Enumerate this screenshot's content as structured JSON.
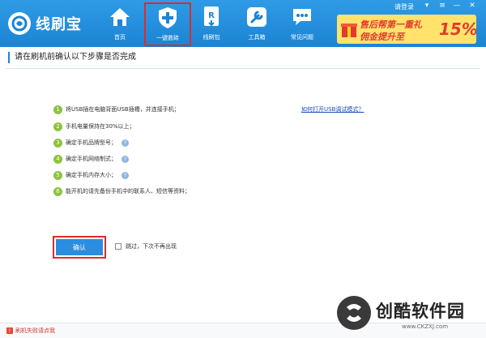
{
  "app": {
    "name": "线刷宝"
  },
  "nav": [
    {
      "label": "首页",
      "icon": "home-icon"
    },
    {
      "label": "一键救砖",
      "icon": "shield-plus-icon",
      "active": true
    },
    {
      "label": "线刷包",
      "icon": "rom-package-icon"
    },
    {
      "label": "工具箱",
      "icon": "wrench-icon"
    },
    {
      "label": "常见问题",
      "icon": "chat-bubble-icon"
    }
  ],
  "header": {
    "login": "请登录",
    "ad": {
      "line1": "售后帮第一重礼",
      "line2": "佣金提升至",
      "percent": "15%"
    }
  },
  "main": {
    "title": "请在刷机前确认以下步骤是否完成",
    "steps": [
      {
        "num": "1",
        "text": "将USB插在电脑背面USB插槽，并连接手机；"
      },
      {
        "num": "2",
        "text": "手机电量保持在30%以上；"
      },
      {
        "num": "3",
        "text": "确定手机品牌型号；",
        "help": "?"
      },
      {
        "num": "4",
        "text": "确定手机网络制式；",
        "help": "?"
      },
      {
        "num": "5",
        "text": "确定手机内存大小；",
        "help": "?"
      },
      {
        "num": "6",
        "text": "能开机的请先备份手机中的联系人、短信等资料；"
      }
    ],
    "usb_debug_link": "如何打开USB调试模式？",
    "confirm_label": "确认",
    "skip_label": "跳过，下次不再出现"
  },
  "status": {
    "link": "刷机失败请点我",
    "warn_glyph": "!"
  },
  "watermark": {
    "text": "创酷软件园",
    "url": "www.CKZXJ.com"
  },
  "colors": {
    "header": "#1b84d4",
    "accent": "#2a8de0",
    "highlight": "#e02b2b",
    "step": "#8dc23f"
  }
}
